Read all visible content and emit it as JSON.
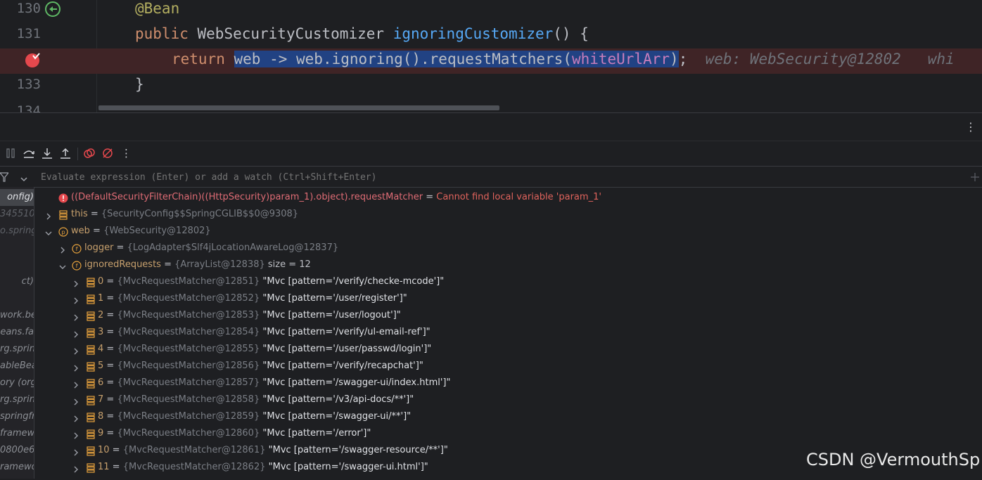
{
  "editor": {
    "lines": [
      {
        "no": "130",
        "annotation": "@Bean"
      },
      {
        "no": "131",
        "kw": "public",
        "type": "WebSecurityCustomizer",
        "method": "ignoringCustomizer",
        "rest": "() {"
      },
      {
        "no": "",
        "kw": "return",
        "selected_pre": "web -> web.ignoring().requestMatchers(",
        "selected_field": "whiteUrlArr",
        "selected_post": ")",
        "after": ";",
        "hint": "web: WebSecurity@12802",
        "hint2": "whi"
      },
      {
        "no": "133",
        "code": "}"
      },
      {
        "no": "134"
      }
    ]
  },
  "toolbar": {
    "buttons": [
      "pause-icon",
      "step-over-icon",
      "step-into-icon",
      "step-out-icon",
      "view-breakpoints-icon",
      "mute-breakpoints-icon",
      "more-icon"
    ]
  },
  "evaluate": {
    "placeholder": "Evaluate expression (Enter) or add a watch (Ctrl+Shift+Enter)"
  },
  "frames": [
    "onfig)",
    "345510",
    "o.spring",
    "",
    "",
    "ct)",
    "",
    "work.be",
    "eans.fa",
    "rg.sprin",
    "ableBean",
    "ory (org",
    "rg.sprin",
    "springfr",
    "framewo",
    "0800e6",
    "ramewo"
  ],
  "variables": {
    "error_row": {
      "expr": "((DefaultSecurityFilterChain)((HttpSecurity)param_1).object).requestMatcher",
      "eq": " = ",
      "message": "Cannot find local variable 'param_1'"
    },
    "this_row": {
      "name": "this",
      "eq": " = ",
      "ref": "{SecurityConfig$$SpringCGLIB$$0@9308}"
    },
    "web_row": {
      "name": "web",
      "eq": " = ",
      "ref": "{WebSecurity@12802}"
    },
    "logger_row": {
      "name": "logger",
      "eq": " = ",
      "ref": "{LogAdapter$Slf4jLocationAwareLog@12837}"
    },
    "ignored_row": {
      "name": "ignoredRequests",
      "eq": " = ",
      "ref": "{ArrayList@12838}",
      "size": " size = 12"
    },
    "items": [
      {
        "idx": "0",
        "ref": "{MvcRequestMatcher@12851}",
        "val": "\"Mvc [pattern='/verify/checke-mcode']\""
      },
      {
        "idx": "1",
        "ref": "{MvcRequestMatcher@12852}",
        "val": "\"Mvc [pattern='/user/register']\""
      },
      {
        "idx": "2",
        "ref": "{MvcRequestMatcher@12853}",
        "val": "\"Mvc [pattern='/user/logout']\""
      },
      {
        "idx": "3",
        "ref": "{MvcRequestMatcher@12854}",
        "val": "\"Mvc [pattern='/verify/ul-email-ref']\""
      },
      {
        "idx": "4",
        "ref": "{MvcRequestMatcher@12855}",
        "val": "\"Mvc [pattern='/user/passwd/login']\""
      },
      {
        "idx": "5",
        "ref": "{MvcRequestMatcher@12856}",
        "val": "\"Mvc [pattern='/verify/recapchat']\""
      },
      {
        "idx": "6",
        "ref": "{MvcRequestMatcher@12857}",
        "val": "\"Mvc [pattern='/swagger-ui/index.html']\""
      },
      {
        "idx": "7",
        "ref": "{MvcRequestMatcher@12858}",
        "val": "\"Mvc [pattern='/v3/api-docs/**']\""
      },
      {
        "idx": "8",
        "ref": "{MvcRequestMatcher@12859}",
        "val": "\"Mvc [pattern='/swagger-ui/**']\""
      },
      {
        "idx": "9",
        "ref": "{MvcRequestMatcher@12860}",
        "val": "\"Mvc [pattern='/error']\""
      },
      {
        "idx": "10",
        "ref": "{MvcRequestMatcher@12861}",
        "val": "\"Mvc [pattern='/swagger-resource/**']\""
      },
      {
        "idx": "11",
        "ref": "{MvcRequestMatcher@12862}",
        "val": "\"Mvc [pattern='/swagger-ui.html']\""
      }
    ]
  },
  "watermark": "CSDN @VermouthSp",
  "colors": {
    "background": "#1e1f22",
    "selection": "#214283",
    "breakpoint_line": "#3f2426",
    "keyword": "#cf8e6d",
    "annotation": "#b3ae60",
    "method": "#56a8f5",
    "field": "#c77dbb",
    "var_name": "#c7a06d",
    "error": "#e0635c"
  }
}
